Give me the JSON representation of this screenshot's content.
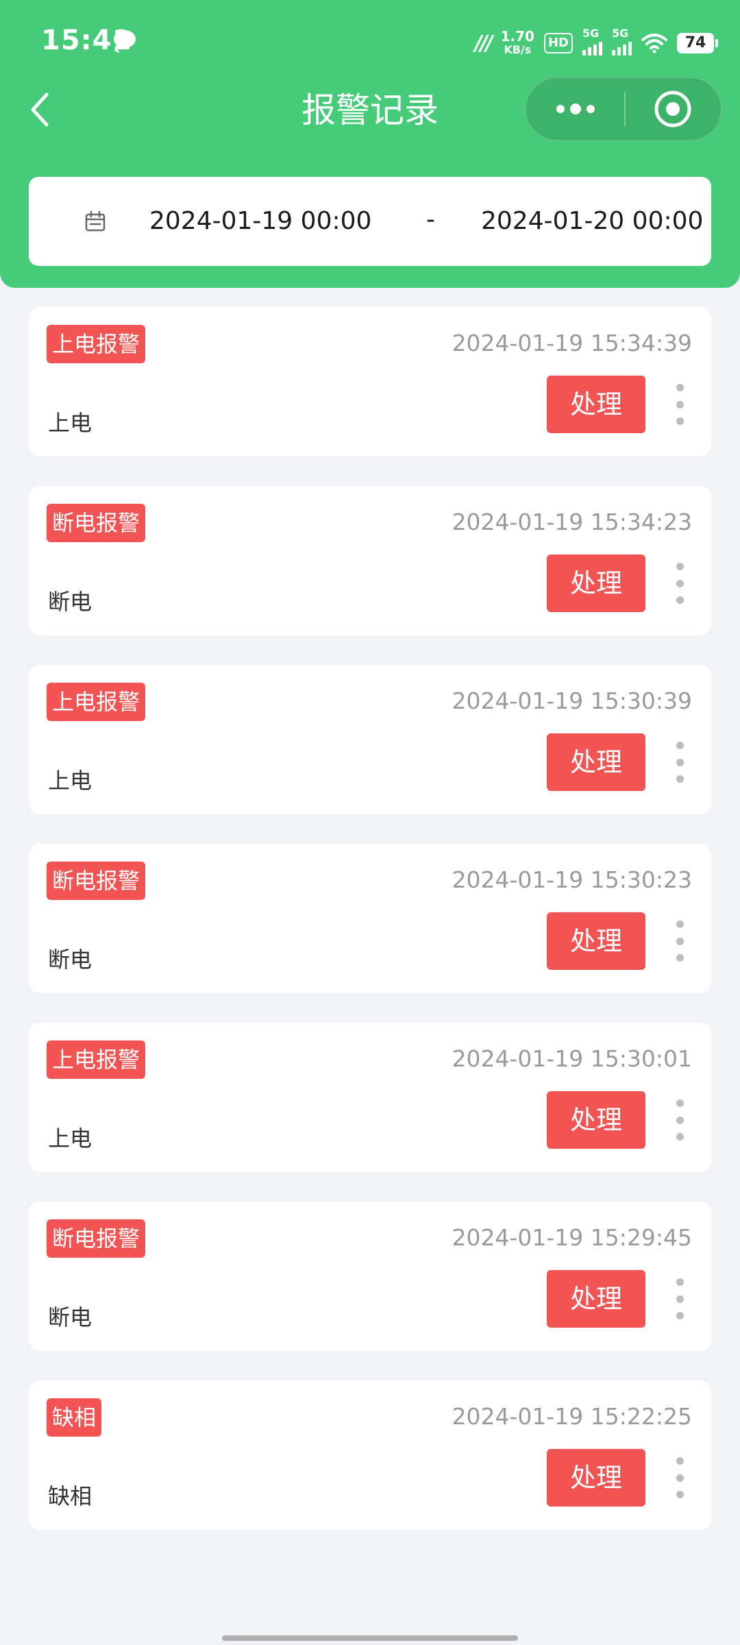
{
  "status_bar": {
    "time": "15:41",
    "speed_value": "1.70",
    "speed_unit": "KB/s",
    "hd_label": "HD",
    "sim1_label": "5G",
    "sim2_label": "5G",
    "battery_level": "74"
  },
  "nav": {
    "title": "报警记录"
  },
  "date_range": {
    "start": "2024-01-19 00:00",
    "separator": "-",
    "end": "2024-01-20 00:00"
  },
  "action_label": "处理",
  "colors": {
    "header": "#46cb78",
    "alarm_red": "#f25454",
    "page_bg": "#f2f3f7"
  },
  "alarms": [
    {
      "tag": "上电报警",
      "time": "2024-01-19 15:34:39",
      "desc": "上电"
    },
    {
      "tag": "断电报警",
      "time": "2024-01-19 15:34:23",
      "desc": "断电"
    },
    {
      "tag": "上电报警",
      "time": "2024-01-19 15:30:39",
      "desc": "上电"
    },
    {
      "tag": "断电报警",
      "time": "2024-01-19 15:30:23",
      "desc": "断电"
    },
    {
      "tag": "上电报警",
      "time": "2024-01-19 15:30:01",
      "desc": "上电"
    },
    {
      "tag": "断电报警",
      "time": "2024-01-19 15:29:45",
      "desc": "断电"
    },
    {
      "tag": "缺相",
      "time": "2024-01-19 15:22:25",
      "desc": "缺相"
    }
  ]
}
